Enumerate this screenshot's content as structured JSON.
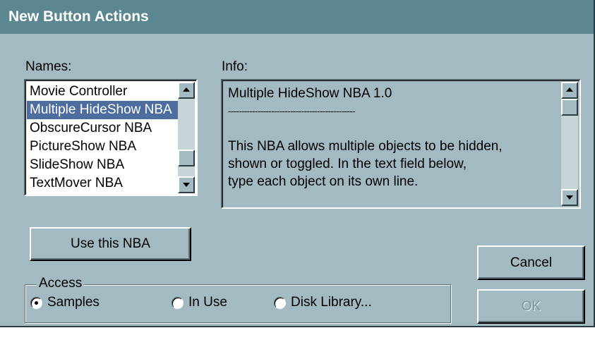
{
  "dialog": {
    "title": "New Button Actions"
  },
  "names": {
    "label": "Names:",
    "items": [
      "Movie Controller",
      "Multiple HideShow NBA",
      "ObscureCursor NBA",
      "PictureShow NBA",
      "SlideShow NBA",
      "TextMover NBA"
    ],
    "selected_index": 1
  },
  "info": {
    "label": "Info:",
    "lines": [
      "Multiple HideShow NBA 1.0",
      "-----------------------------------------------",
      "",
      "This NBA allows multiple objects to be hidden,",
      "shown or toggled.  In the text field below,",
      "type each object on its own line."
    ]
  },
  "buttons": {
    "use": "Use this NBA",
    "cancel": "Cancel",
    "ok": "OK"
  },
  "access": {
    "label": "Access",
    "options": [
      "Samples",
      "In Use",
      "Disk Library..."
    ],
    "selected": "Samples"
  },
  "icons": {
    "scroll_up": "arrow-up-icon",
    "scroll_down": "arrow-down-icon",
    "radio": "radio-button-icon"
  },
  "colors": {
    "dialog_bg": "#a3bac2",
    "title_bar": "#5b8790",
    "selection": "#4d6d9e"
  }
}
